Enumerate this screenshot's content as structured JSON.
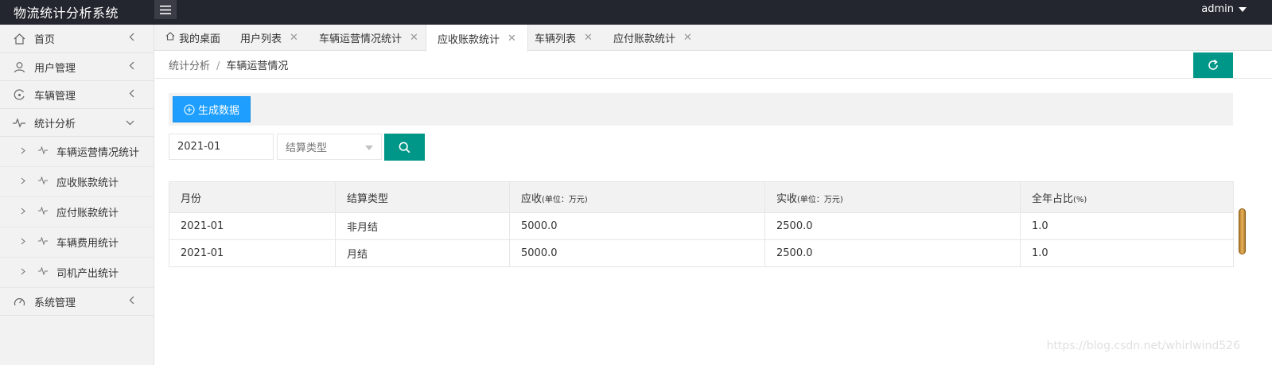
{
  "app": {
    "title": "物流统计分析系统",
    "user": "admin"
  },
  "sidebar": {
    "items": [
      {
        "label": "首页"
      },
      {
        "label": "用户管理"
      },
      {
        "label": "车辆管理"
      },
      {
        "label": "统计分析"
      },
      {
        "label": "系统管理"
      }
    ],
    "sub_items": [
      {
        "label": "车辆运营情况统计"
      },
      {
        "label": "应收账款统计"
      },
      {
        "label": "应付账款统计"
      },
      {
        "label": "车辆费用统计"
      },
      {
        "label": "司机产出统计"
      }
    ]
  },
  "tabs": [
    {
      "label": "我的桌面"
    },
    {
      "label": "用户列表"
    },
    {
      "label": "车辆运营情况统计"
    },
    {
      "label": "应收账款统计"
    },
    {
      "label": "车辆列表"
    },
    {
      "label": "应付账款统计"
    }
  ],
  "breadcrumb": {
    "parent": "统计分析",
    "separator": "/",
    "current": "车辆运营情况"
  },
  "toolbar": {
    "generate_label": "生成数据"
  },
  "search": {
    "date_value": "2021-01",
    "type_placeholder": "结算类型"
  },
  "table": {
    "headers": [
      {
        "label": "月份",
        "unit": ""
      },
      {
        "label": "结算类型",
        "unit": ""
      },
      {
        "label": "应收",
        "unit": "(单位：万元)"
      },
      {
        "label": "实收",
        "unit": "(单位：万元)"
      },
      {
        "label": "全年占比",
        "unit": "(%)"
      }
    ],
    "rows": [
      [
        "2021-01",
        "非月结",
        "5000.0",
        "2500.0",
        "1.0"
      ],
      [
        "2021-01",
        "月结",
        "5000.0",
        "2500.0",
        "1.0"
      ]
    ]
  },
  "watermark": "https://blog.csdn.net/whirlwind526"
}
